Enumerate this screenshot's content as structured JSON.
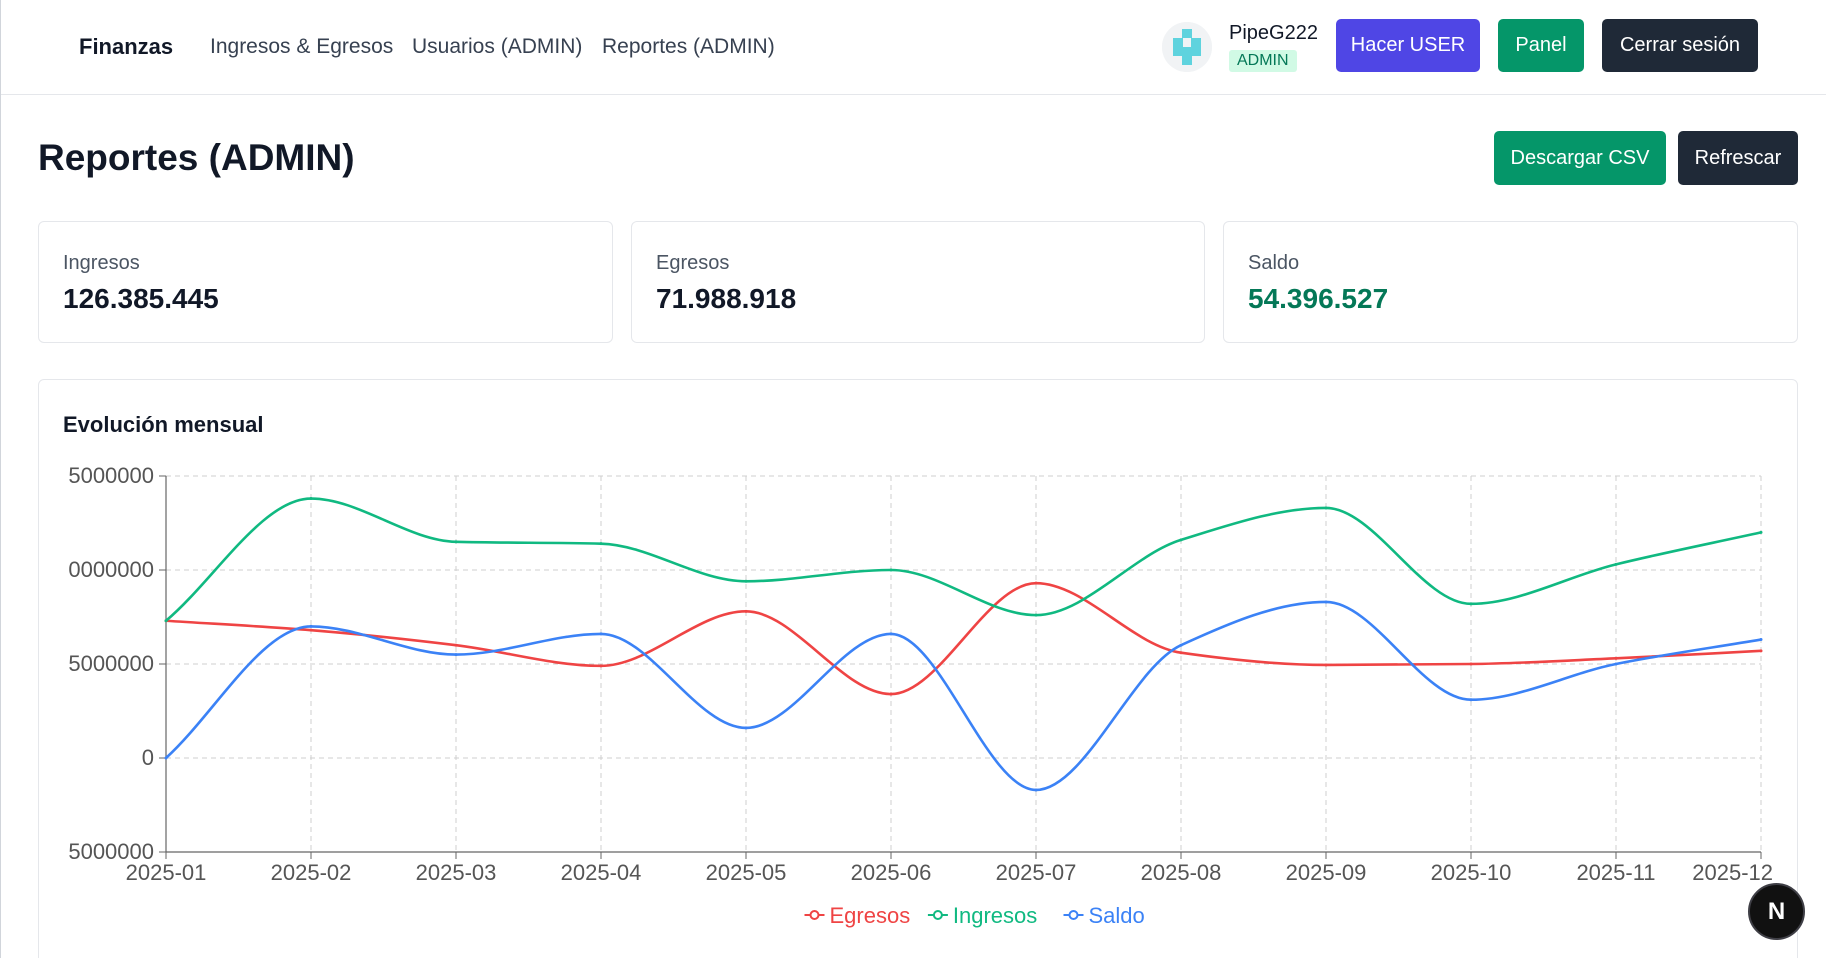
{
  "navbar": {
    "brand": "Finanzas",
    "links": [
      "Ingresos & Egresos",
      "Usuarios (ADMIN)",
      "Reportes (ADMIN)"
    ],
    "user": {
      "name": "PipeG222",
      "role": "ADMIN"
    },
    "buttons": {
      "make_user": "Hacer USER",
      "panel": "Panel",
      "logout": "Cerrar sesión"
    }
  },
  "page": {
    "title": "Reportes (ADMIN)",
    "buttons": {
      "download_csv": "Descargar CSV",
      "refresh": "Refrescar"
    }
  },
  "stats": [
    {
      "label": "Ingresos",
      "value": "126.385.445"
    },
    {
      "label": "Egresos",
      "value": "71.988.918"
    },
    {
      "label": "Saldo",
      "value": "54.396.527"
    }
  ],
  "colors": {
    "egresos": "#ef4444",
    "ingresos": "#10b981",
    "saldo": "#3b82f6",
    "accent_indigo": "#4f46e5",
    "accent_green": "#059669",
    "dark": "#1f2937"
  },
  "chart_data": {
    "type": "line",
    "title": "Evolución mensual",
    "x": [
      "2025-01",
      "2025-02",
      "2025-03",
      "2025-04",
      "2025-05",
      "2025-06",
      "2025-07",
      "2025-08",
      "2025-09",
      "2025-10",
      "2025-11",
      "2025-12"
    ],
    "ylim": [
      -5000000,
      15000000
    ],
    "ytick_labels": [
      "5000000",
      "0000000",
      "5000000",
      "0",
      "5000000"
    ],
    "grid": true,
    "legend_position": "bottom",
    "series": [
      {
        "name": "Egresos",
        "color": "#ef4444",
        "values": [
          7300000,
          6800000,
          6000000,
          4900000,
          7800000,
          3400000,
          9300000,
          5600000,
          4950000,
          5000000,
          5300000,
          5700000
        ]
      },
      {
        "name": "Ingresos",
        "color": "#10b981",
        "values": [
          7300000,
          13800000,
          11500000,
          11400000,
          9400000,
          10000000,
          7600000,
          11600000,
          13300000,
          8200000,
          10300000,
          12000000
        ]
      },
      {
        "name": "Saldo",
        "color": "#3b82f6",
        "values": [
          0,
          7000000,
          5500000,
          6600000,
          1600000,
          6600000,
          -1700000,
          6000000,
          8300000,
          3100000,
          5000000,
          6300000
        ]
      }
    ]
  },
  "floating": {
    "label": "N"
  }
}
